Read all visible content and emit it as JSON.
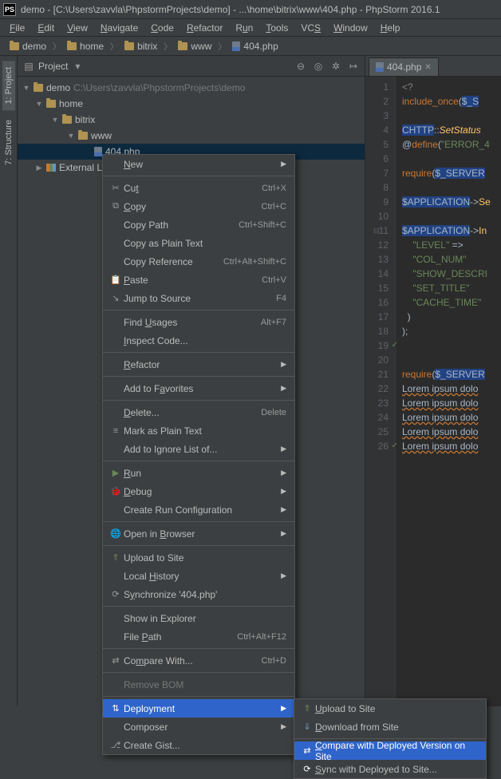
{
  "title": "demo - [C:\\Users\\zavvla\\PhpstormProjects\\demo] - ...\\home\\bitrix\\www\\404.php - PhpStorm 2016.1",
  "menus": {
    "file": "File",
    "edit": "Edit",
    "view": "View",
    "navigate": "Navigate",
    "code": "Code",
    "refactor": "Refactor",
    "run": "Run",
    "tools": "Tools",
    "vcs": "VCS",
    "window": "Window",
    "help": "Help"
  },
  "breadcrumbs": {
    "demo": "demo",
    "home": "home",
    "bitrix": "bitrix",
    "www": "www",
    "file": "404.php"
  },
  "project_panel": {
    "title": "Project"
  },
  "side_tabs": {
    "project": "1: Project",
    "structure": "7: Structure"
  },
  "tree": {
    "root": "demo",
    "root_path": "C:\\Users\\zavvla\\PhpstormProjects\\demo",
    "home": "home",
    "bitrix": "bitrix",
    "www": "www",
    "file": "404.php",
    "ext_lib": "External Libra"
  },
  "editor_tab": {
    "name": "404.php"
  },
  "gutter_lines": [
    "1",
    "2",
    "3",
    "4",
    "5",
    "6",
    "7",
    "8",
    "9",
    "10",
    "11",
    "12",
    "13",
    "14",
    "15",
    "16",
    "17",
    "18",
    "19",
    "20",
    "21",
    "22",
    "23",
    "24",
    "25",
    "26"
  ],
  "code": {
    "l1": "<?",
    "l2a": "include_once",
    "l2b": "(",
    "l2c": "$_S",
    "l4a": "CHTTP",
    "l4b": "::",
    "l4c": "SetStatus",
    "l5a": "@",
    "l5b": "define",
    "l5c": "(",
    "l5d": "\"ERROR_4",
    "l7a": "require",
    "l7b": "(",
    "l7c": "$_SERVER",
    "l9a": "$APPLICATION",
    "l9b": "->",
    "l9c": "Se",
    "l11a": "$APPLICATION",
    "l11b": "->",
    "l11c": "In",
    "l12": "\"LEVEL\"",
    "l12b": " =>",
    "l13": "\"COL_NUM\"",
    "l14": "\"SHOW_DESCRI",
    "l15": "\"SET_TITLE\"",
    "l16": "\"CACHE_TIME\"",
    "l17": ")",
    "l18": ");",
    "l21a": "require",
    "l21b": "(",
    "l21c": "$_SERVER",
    "l22": "Lorem ipsum dolo",
    "l23": "Lorem ipsum dolo",
    "l24": "Lorem ipsum dolo",
    "l25": "Lorem ipsum dolo",
    "l26": "Lorem ipsum dolo"
  },
  "ctx": {
    "new": "New",
    "cut": "Cut",
    "cut_sc": "Ctrl+X",
    "copy": "Copy",
    "copy_sc": "Ctrl+C",
    "copy_path": "Copy Path",
    "copy_path_sc": "Ctrl+Shift+C",
    "copy_plain": "Copy as Plain Text",
    "copy_ref": "Copy Reference",
    "copy_ref_sc": "Ctrl+Alt+Shift+C",
    "paste": "Paste",
    "paste_sc": "Ctrl+V",
    "jump_src": "Jump to Source",
    "jump_src_sc": "F4",
    "find_usages": "Find Usages",
    "find_usages_sc": "Alt+F7",
    "inspect": "Inspect Code...",
    "refactor": "Refactor",
    "add_fav": "Add to Favorites",
    "delete": "Delete...",
    "delete_sc": "Delete",
    "mark_plain": "Mark as Plain Text",
    "add_ignore": "Add to Ignore List of...",
    "run": "Run",
    "debug": "Debug",
    "create_run": "Create Run Configuration",
    "open_browser": "Open in Browser",
    "upload": "Upload to Site",
    "local_history": "Local History",
    "sync": "Synchronize '404.php'",
    "show_explorer": "Show in Explorer",
    "file_path": "File Path",
    "file_path_sc": "Ctrl+Alt+F12",
    "compare_with": "Compare With...",
    "compare_with_sc": "Ctrl+D",
    "remove_bom": "Remove BOM",
    "deployment": "Deployment",
    "composer": "Composer",
    "create_gist": "Create Gist..."
  },
  "sub": {
    "upload": "Upload to Site",
    "download": "Download from Site",
    "compare": "Compare with Deployed Version on Site",
    "sync": "Sync with Deployed to Site..."
  }
}
